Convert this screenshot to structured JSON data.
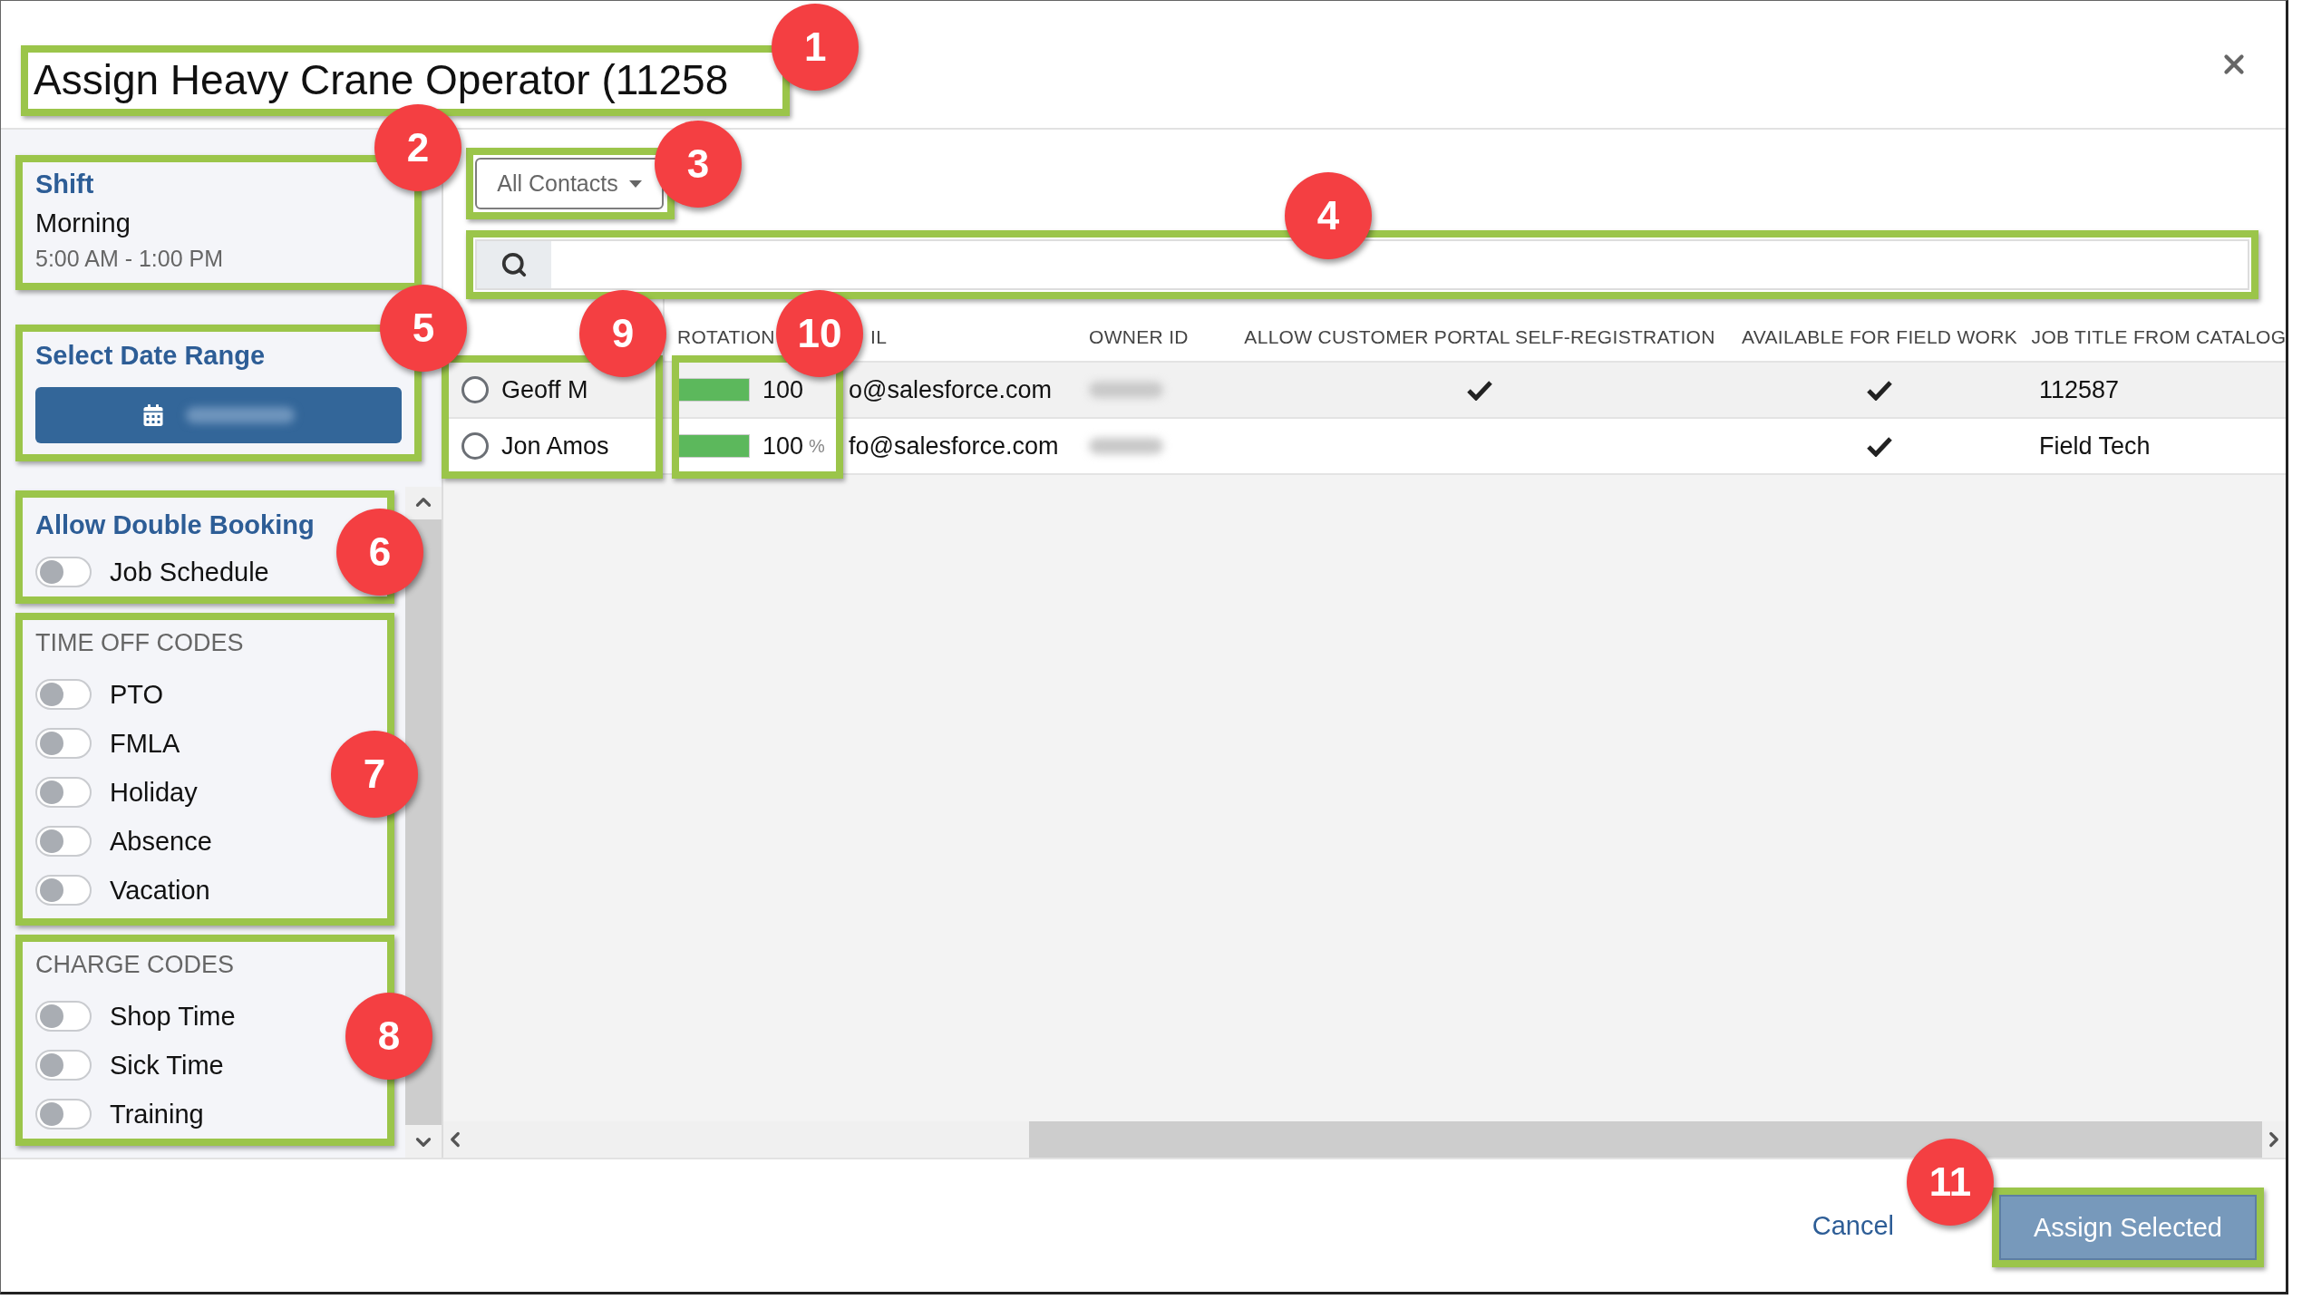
{
  "dialog": {
    "title": "Assign Heavy Crane Operator (11258",
    "callout": "1"
  },
  "shift": {
    "heading": "Shift",
    "name": "Morning",
    "hours": "5:00 AM - 1:00 PM",
    "callout": "2"
  },
  "date_range": {
    "heading": "Select Date Range",
    "callout": "5"
  },
  "double_booking": {
    "heading": "Allow Double Booking",
    "callout": "6",
    "toggles": [
      {
        "label": "Job Schedule",
        "on": false
      }
    ]
  },
  "time_off_codes": {
    "heading": "TIME OFF CODES",
    "callout": "7",
    "toggles": [
      {
        "label": "PTO",
        "on": false
      },
      {
        "label": "FMLA",
        "on": false
      },
      {
        "label": "Holiday",
        "on": false
      },
      {
        "label": "Absence",
        "on": false
      },
      {
        "label": "Vacation",
        "on": false
      }
    ]
  },
  "charge_codes": {
    "heading": "CHARGE CODES",
    "callout": "8",
    "toggles": [
      {
        "label": "Shop Time",
        "on": false
      },
      {
        "label": "Sick Time",
        "on": false
      },
      {
        "label": "Training",
        "on": false
      }
    ]
  },
  "filter": {
    "value": "All Contacts",
    "callout": "3"
  },
  "search": {
    "callout": "4"
  },
  "table": {
    "columns": [
      "ROTATION",
      "IL",
      "OWNER ID",
      "ALLOW CUSTOMER PORTAL SELF-REGISTRATION",
      "AVAILABLE FOR FIELD WORK",
      "JOB TITLE FROM CATALOG"
    ],
    "name_callout": "9",
    "rotation_callout": "10",
    "rows": [
      {
        "name": "Geoff M",
        "selected": false,
        "level": 1,
        "rotation": "100",
        "email": "o@salesforce.com",
        "portal_self_registration": true,
        "field_work": true,
        "job_title": "112587"
      },
      {
        "name": "Jon Amos",
        "selected": false,
        "level": 1,
        "rotation": "100",
        "unit": "%",
        "email": "fo@salesforce.com",
        "portal_self_registration": false,
        "field_work": true,
        "job_title": "Field Tech"
      }
    ]
  },
  "footer": {
    "cancel": "Cancel",
    "assign": "Assign Selected",
    "callout": "11"
  }
}
